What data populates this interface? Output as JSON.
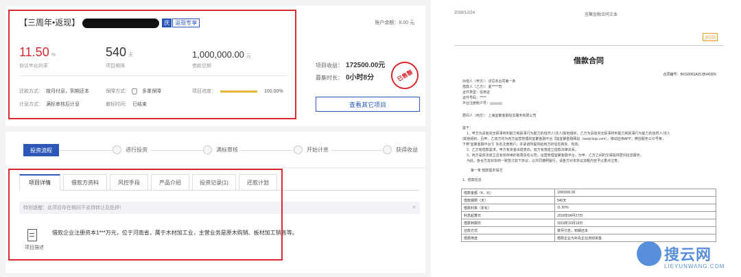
{
  "product": {
    "title": "【三周年•返现】",
    "tag_a": "庆",
    "tag_b": "返现专享",
    "balance": "账户余额：8.00 元",
    "rate": {
      "value": "11.50",
      "unit": "%",
      "label": "协议年化利率"
    },
    "term": {
      "value": "540",
      "unit": "天",
      "label": "项目期限"
    },
    "total": {
      "value": "1,000,000.00",
      "unit": "元",
      "label": "借款总额"
    },
    "repay": {
      "label": "还款方式：",
      "value": "按月付息，到期还本"
    },
    "guarantee": {
      "label": "保障方式：",
      "value": "多重保障"
    },
    "progress": {
      "label": "项目进度：",
      "value": "100.00%",
      "fraction": 1.0
    },
    "interest": {
      "label": "计息方式：",
      "value": "满标审核后计息"
    },
    "deadline": {
      "label": "撤标时间：",
      "value": "已结束"
    },
    "income": {
      "label": "项目收益：",
      "value": "172500.00元"
    },
    "fund_time": {
      "label": "募集时长：",
      "value": "0小时8分"
    },
    "stamp": "已售罄",
    "other_button": "查看其它项目"
  },
  "flow": {
    "active": "投资流程",
    "steps": [
      "进行投资",
      "满标审核",
      "开始计息",
      "获得收益"
    ]
  },
  "tabs": {
    "items": [
      "项目详情",
      "借款方资料",
      "风控手段",
      "产品介绍",
      "投资记录(1)",
      "还款计划"
    ],
    "notice": "特别提醒：此项目存在期间不支持转让及抵押！",
    "notice_close": "×",
    "desc_label": "项目描述",
    "desc_text": "借款企业注册资本1***万元，位于河南省，属于木材加工业，主营业务是原木购销、板材加工销售等。"
  },
  "contract": {
    "date": "2018/12/24",
    "header": "宜聚金融合同文本",
    "print": "[打印]",
    "title": "借款合同",
    "number": "合同编号：BXSD061A日18040305",
    "lender": "出借人（甲方）：详见本合同第一条",
    "borrower": "借款人（乙方）：夏*****司",
    "id_type": "证件类型：信用证",
    "id_no": "证件号码：*****",
    "platform_id": "平台注册账户号：",
    "mediator": "居间人（丙方）：上海宜聚金融信息服务有限公司",
    "whereas": "鉴于：",
    "p1a": "1、甲方为具有完全民事权利能力和民事行为能力的自然人/法人/其他组织，乙方为具有完全民事权利能力和民事行为能力的自然人/法人",
    "p1b": "/其他组织，且甲、乙双方均为丙方运营管理的宜聚金融平台【指宜聚金融网站（www.bojx.com），移动应用APP，微信服务公众号等，",
    "p1c": "下称“宜聚金融平台”】实名注册用户，并承诺所提供给丙方的信息真实、有效；",
    "p2": "2、乙方有借款需求，甲方有资金出借意向，双方有意成立借款法律关系；",
    "p3": "3、丙方是依法成立且有效存续的有限责任公司，运营管理宜聚金融平台，为甲、乙方之间的交易提供居间信息服务；",
    "p4": "为此，各合方友好协商一致签订如下协议，以共同遵照履行，请各方对本协议加粗内容予以重点注意。",
    "art1": "第一条  借款基本情况",
    "sec1": "1、借款信息",
    "table": [
      [
        "借款金额（¥，元）",
        "1000000.00"
      ],
      [
        "借款期限（天）",
        "540天"
      ],
      [
        "借款利率（年化）",
        "11.50%"
      ],
      [
        "利息起算日",
        "2018年04月27日"
      ],
      [
        "借款到期日",
        "2019年10月19日"
      ],
      [
        "还款方式",
        "按月付息，到期还本"
      ],
      [
        "借款用途",
        "借款企业为补充企业流动资金"
      ]
    ]
  },
  "watermark": {
    "text": "搜云网",
    "sub": "LIEYUNWANG.COM"
  }
}
